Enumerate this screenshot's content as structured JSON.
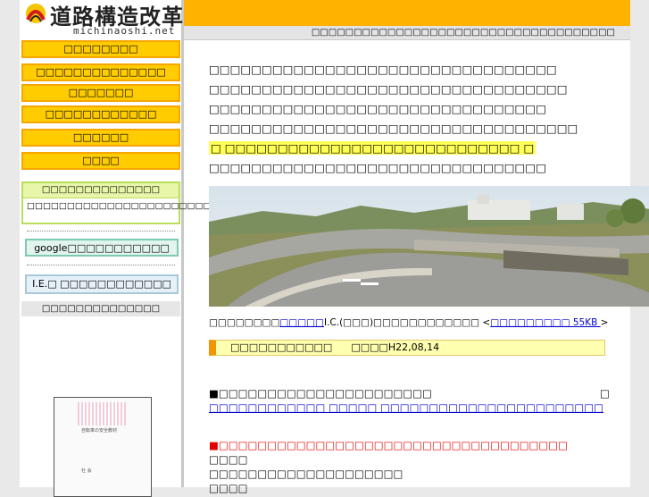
{
  "site": {
    "title": "道路構造改革",
    "domain": "michinaoshi.net",
    "tagline": "□□□□□□□□□□□□□□□□□□□□□□□□□□□□□□□□□□□□"
  },
  "nav": [
    {
      "label": "□□□□□□□□"
    },
    {
      "label": "□□□□□□□□□□□□□□"
    },
    {
      "label": "□□□□□□□"
    },
    {
      "label": "□□□□□□□□□□□□"
    },
    {
      "label": "□□□□□□"
    },
    {
      "label": "□□□□"
    }
  ],
  "update_box": {
    "title": "□□□□□□□□□□□□□□",
    "body": "□□□□□□□□□□□□□□□□□□□□□□□□□□□□□□"
  },
  "side_buttons": {
    "google": "google□□□□□□□□□□□",
    "ie": "I.E.□ □□□□□□□□□□□□"
  },
  "side_subtitle": "□□□□□□□□□□□□□□",
  "book": {
    "cover_text": "自転車の安全教材",
    "cover_sub": "社 会"
  },
  "intro": [
    "□□□□□□□□□□□□□□□□□□□□□□□□□□□□□□□□□",
    "□□□□□□□□□□□□□□□□□□□□□□□□□□□□□□□□□□",
    "□□□□□□□□□□□□□□□□□□□□□□□□□□□□□□□□",
    "□□□□□□□□□□□□□□□□□□□□□□□□□□□□□□□□□□□",
    "□ □□□□□□□□□□□□□□□□□□□□□□□□□□□□ □",
    "□□□□□□□□□□□□□□□□□□□□□□□□□□□□□□□□"
  ],
  "caption": {
    "prefix": "□□□□□□□□",
    "link1": "□□□□□",
    "middle": "I.C.(□□□)□□□□□□□□□□□□ <",
    "link2": "□□□□□□□□□ 55KB ",
    "suffix": ">"
  },
  "news_header": {
    "label": "□□□□□□□□□□□",
    "date": "□□□□H22,08,14"
  },
  "news": {
    "item1": "■□□□□□□□□□□□□□□□□□□□□□□",
    "item1_mark": "□",
    "item1_link": " □□□□□□□□□□□□ □□□□□ □□□□□□□□□□□□□□□□□□□□□□□",
    "item2": "■□□□□□□□□□□□□□□□□□□□□□□□□□□□□□□□□□□□□",
    "line3": "□□□□",
    "line4": "□□□□□□□□□□□□□□□□□□□□",
    "line5": "□□□□"
  }
}
